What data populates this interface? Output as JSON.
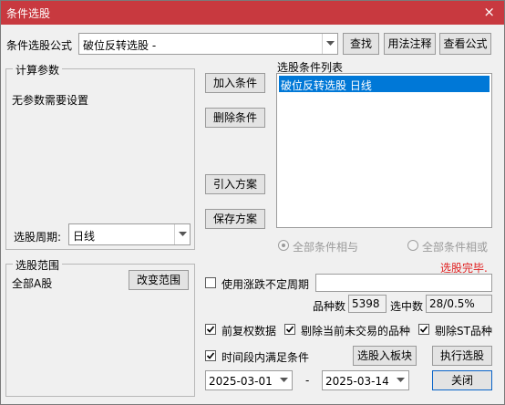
{
  "window": {
    "title": "条件选股",
    "close_glyph": "×"
  },
  "formula": {
    "label": "条件选股公式",
    "value": "破位反转选股 -",
    "find_button": "查找",
    "usage_button": "用法注释",
    "view_button": "查看公式"
  },
  "params": {
    "group_title": "计算参数",
    "message": "无参数需要设置",
    "period_label": "选股周期:",
    "period_value": "日线"
  },
  "buttons": {
    "add": "加入条件",
    "delete": "删除条件",
    "import": "引入方案",
    "save": "保存方案",
    "change_range": "改变范围",
    "to_block": "选股入板块",
    "execute": "执行选股",
    "close": "关闭"
  },
  "condition_list": {
    "title": "选股条件列表",
    "items": [
      "破位反转选股  日线"
    ]
  },
  "logic": {
    "and_label": "全部条件相与",
    "or_label": "全部条件相或"
  },
  "status": {
    "text": "选股完毕.",
    "color": "#e02020"
  },
  "range": {
    "group_title": "选股范围",
    "value": "全部A股"
  },
  "irregular": {
    "label": "使用涨跌不定周期",
    "checked": false,
    "value": ""
  },
  "stats": {
    "count_label": "品种数",
    "count_value": "5398",
    "hit_label": "选中数",
    "hit_value": "28/0.5%"
  },
  "options": {
    "adjust": {
      "label": "前复权数据",
      "checked": true
    },
    "exclude_untraded": {
      "label": "剔除当前未交易的品种",
      "checked": true
    },
    "exclude_st": {
      "label": "剔除ST品种",
      "checked": true
    },
    "time_range": {
      "label": "时间段内满足条件",
      "checked": true
    }
  },
  "dates": {
    "start": "2025-03-01",
    "separator": "-",
    "end": "2025-03-14"
  },
  "colors": {
    "title_bar": "#c8393f",
    "selection": "#0078d7"
  }
}
